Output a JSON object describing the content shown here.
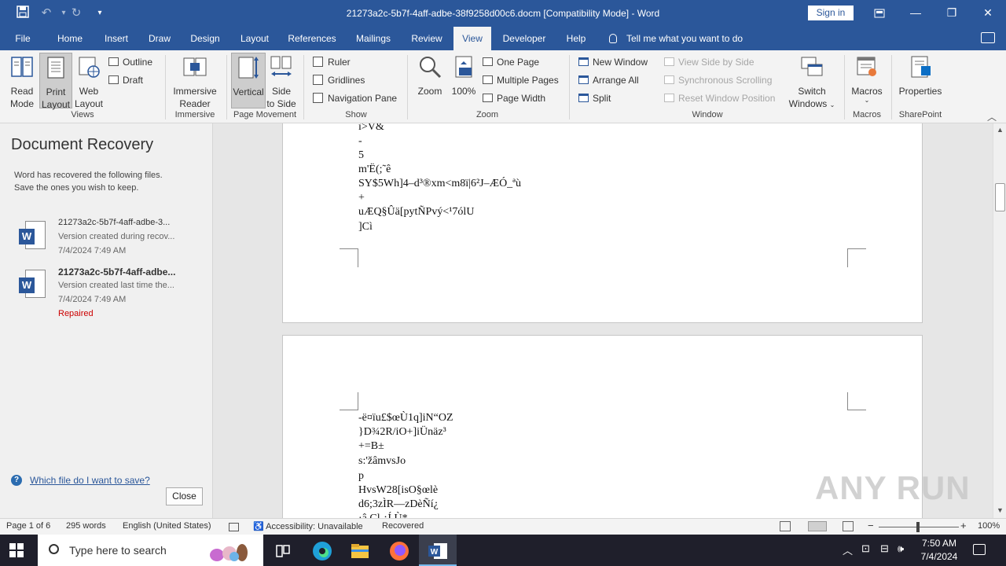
{
  "window": {
    "title": "21273a2c-5b7f-4aff-adbe-38f9258d00c6.docm [Compatibility Mode]  -  Word",
    "sign_in": "Sign in"
  },
  "tabs": [
    "File",
    "Home",
    "Insert",
    "Draw",
    "Design",
    "Layout",
    "References",
    "Mailings",
    "Review",
    "View",
    "Developer",
    "Help"
  ],
  "active_tab": "View",
  "tell_me": "Tell me what you want to do",
  "ribbon": {
    "views": {
      "read_mode_1": "Read",
      "read_mode_2": "Mode",
      "print_layout_1": "Print",
      "print_layout_2": "Layout",
      "web_layout_1": "Web",
      "web_layout_2": "Layout",
      "outline": "Outline",
      "draft": "Draft",
      "group": "Views"
    },
    "immersive": {
      "reader_1": "Immersive",
      "reader_2": "Reader",
      "group": "Immersive"
    },
    "page_movement": {
      "vertical": "Vertical",
      "side_1": "Side",
      "side_2": "to Side",
      "group": "Page Movement"
    },
    "show": {
      "ruler": "Ruler",
      "gridlines": "Gridlines",
      "navigation_pane": "Navigation Pane",
      "group": "Show"
    },
    "zoom": {
      "zoom": "Zoom",
      "hundred": "100%",
      "one_page": "One Page",
      "multiple_pages": "Multiple Pages",
      "page_width": "Page Width",
      "group": "Zoom"
    },
    "window": {
      "new_window": "New Window",
      "arrange_all": "Arrange All",
      "split": "Split",
      "view_side_by_side": "View Side by Side",
      "sync_scrolling": "Synchronous Scrolling",
      "reset_position": "Reset Window Position",
      "switch_1": "Switch",
      "switch_2": "Windows",
      "group": "Window"
    },
    "macros": {
      "label": "Macros",
      "group": "Macros"
    },
    "sharepoint": {
      "label": "Properties",
      "group": "SharePoint"
    }
  },
  "recovery": {
    "title": "Document Recovery",
    "desc_1": "Word has recovered the following files.",
    "desc_2": "Save the ones you wish to keep.",
    "files": [
      {
        "name": "21273a2c-5b7f-4aff-adbe-3...",
        "sub": "Version created during recov...",
        "date": "7/4/2024 7:49 AM",
        "status": ""
      },
      {
        "name": "21273a2c-5b7f-4aff-adbe...",
        "sub": "Version created last time the...",
        "date": "7/4/2024 7:49 AM",
        "status": "Repaired"
      }
    ],
    "help_link": "Which file do I want to save?",
    "close": "Close"
  },
  "document": {
    "page1_lines": [
      "ì>V&",
      "-",
      "5",
      "m'Ë(;˜ê",
      "SY$5Wh]4–d³®xm<m8ï|6²J–ÆÓ_ªù",
      "+",
      "uÆQ§Ûä[pytÑPvý<¹7ólU",
      "]Cì"
    ],
    "page2_lines": [
      "-ë¤ïu£$œÙ1q]iN“OZ",
      "}D¾2R/iO+]iÜnäz³",
      "+=B±",
      "s:'žâmvsJo",
      "p",
      "HvsW28[isO§œlè",
      "d6;3zÌR—zDèÑí¿",
      "·â  Cl  ¿Í  Ù*"
    ]
  },
  "watermark": "ANY RUN",
  "status": {
    "page": "Page 1 of 6",
    "words": "295 words",
    "language": "English (United States)",
    "accessibility": "Accessibility: Unavailable",
    "recovered": "Recovered",
    "zoom": "100%"
  },
  "taskbar": {
    "search_placeholder": "Type here to search",
    "time": "7:50 AM",
    "date": "7/4/2024"
  },
  "colors": {
    "word_blue": "#2b579a",
    "repaired_red": "#c00000",
    "taskbar": "#1f1f2b"
  }
}
